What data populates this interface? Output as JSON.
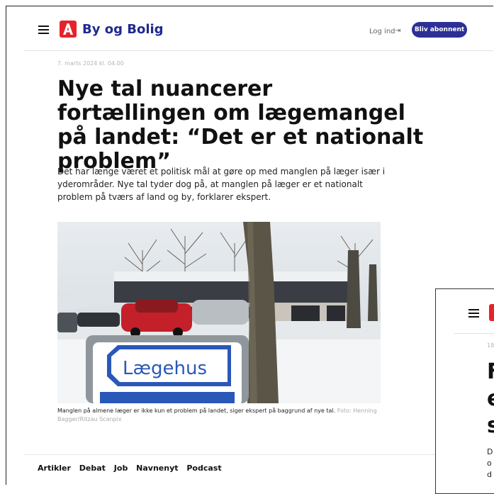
{
  "header": {
    "brand": "By og Bolig",
    "login_label": "Log ind",
    "subscribe_label": "Bliv abonnent"
  },
  "article": {
    "date": "7. marts 2024 kl. 04.00",
    "title": "Nye tal nuancerer fortællingen om lægemangel på landet: “Det er et nationalt problem”",
    "lead": "Det har længe været et politisk mål at gøre op med manglen på læger især i yderområder. Nye tal tyder dog på, at manglen på læger er et nationalt problem på tværs af land og by, forklarer ekspert.",
    "image_sign_text": "Lægehus",
    "caption": "Manglen på almene læger er ikke kun et problem på landet, siger ekspert på baggrund af nye tal.",
    "credit": "Foto: Henning Bagger/Ritzau Scanpix"
  },
  "footer": {
    "nav": [
      "Artikler",
      "Debat",
      "Job",
      "Navnenyt",
      "Podcast"
    ]
  },
  "second_window": {
    "date_fragment": "18",
    "title_lines": [
      "F",
      "e",
      "s"
    ],
    "lead_lines": [
      "D",
      "o",
      "d"
    ]
  },
  "colors": {
    "brand_red": "#e52329",
    "brand_blue": "#1f2a8f",
    "subscribe_bg": "#2c2f95"
  }
}
